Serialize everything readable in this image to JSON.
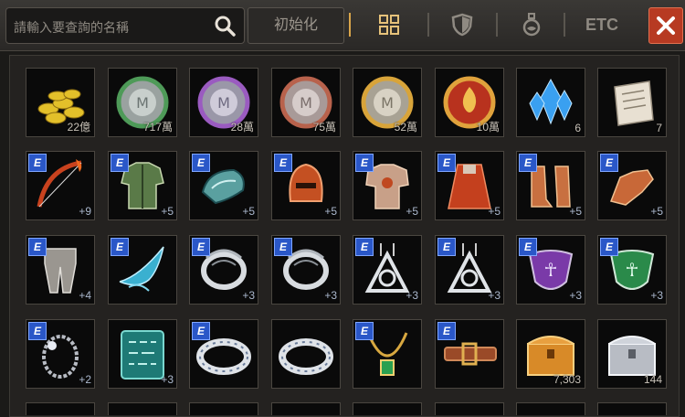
{
  "search": {
    "placeholder": "請輸入要查詢的名稱",
    "reset_label": "初始化"
  },
  "tabs": {
    "etc_label": "ETC"
  },
  "colors": {
    "accent": "#d9a54a",
    "close": "#b73a22",
    "enchant_badge": "#2a57c8"
  },
  "items": [
    {
      "icon": "gold-coins-icon",
      "qty": "22億",
      "e": false
    },
    {
      "icon": "green-coin-icon",
      "qty": "717萬",
      "e": false
    },
    {
      "icon": "purple-coin-icon",
      "qty": "28萬",
      "e": false
    },
    {
      "icon": "red-coin-icon",
      "qty": "75萬",
      "e": false
    },
    {
      "icon": "gold-coin-icon",
      "qty": "52萬",
      "e": false
    },
    {
      "icon": "fire-emblem-coin-icon",
      "qty": "10萬",
      "e": false
    },
    {
      "icon": "blue-crystal-icon",
      "qty": "6",
      "e": false
    },
    {
      "icon": "scroll-icon",
      "qty": "7",
      "e": false
    },
    {
      "icon": "bow-icon",
      "qty": "+9",
      "e": true
    },
    {
      "icon": "green-armor-icon",
      "qty": "+5",
      "e": true
    },
    {
      "icon": "gauntlet-icon",
      "qty": "+5",
      "e": true
    },
    {
      "icon": "helmet-icon",
      "qty": "+5",
      "e": true
    },
    {
      "icon": "chest-armor-icon",
      "qty": "+5",
      "e": true
    },
    {
      "icon": "cloak-icon",
      "qty": "+5",
      "e": true
    },
    {
      "icon": "boots-icon",
      "qty": "+5",
      "e": true
    },
    {
      "icon": "gloves-icon",
      "qty": "+5",
      "e": true
    },
    {
      "icon": "leg-armor-icon",
      "qty": "+4",
      "e": true
    },
    {
      "icon": "blue-wing-icon",
      "qty": "",
      "e": true
    },
    {
      "icon": "silver-ring-icon",
      "qty": "+3",
      "e": true
    },
    {
      "icon": "silver-ring-icon",
      "qty": "+3",
      "e": true
    },
    {
      "icon": "earring-icon",
      "qty": "+3",
      "e": true
    },
    {
      "icon": "earring-icon",
      "qty": "+3",
      "e": true
    },
    {
      "icon": "purple-amulet-icon",
      "qty": "+3",
      "e": true
    },
    {
      "icon": "green-amulet-icon",
      "qty": "+3",
      "e": true
    },
    {
      "icon": "bracelet-icon",
      "qty": "+2",
      "e": true
    },
    {
      "icon": "rune-tablet-icon",
      "qty": "+3",
      "e": false
    },
    {
      "icon": "silver-band-icon",
      "qty": "",
      "e": true
    },
    {
      "icon": "silver-band-icon",
      "qty": "",
      "e": false
    },
    {
      "icon": "necklace-icon",
      "qty": "",
      "e": true
    },
    {
      "icon": "belt-icon",
      "qty": "",
      "e": true
    },
    {
      "icon": "gold-chest-icon",
      "qty": "7,303",
      "e": false
    },
    {
      "icon": "silver-chest-icon",
      "qty": "144",
      "e": false
    }
  ]
}
